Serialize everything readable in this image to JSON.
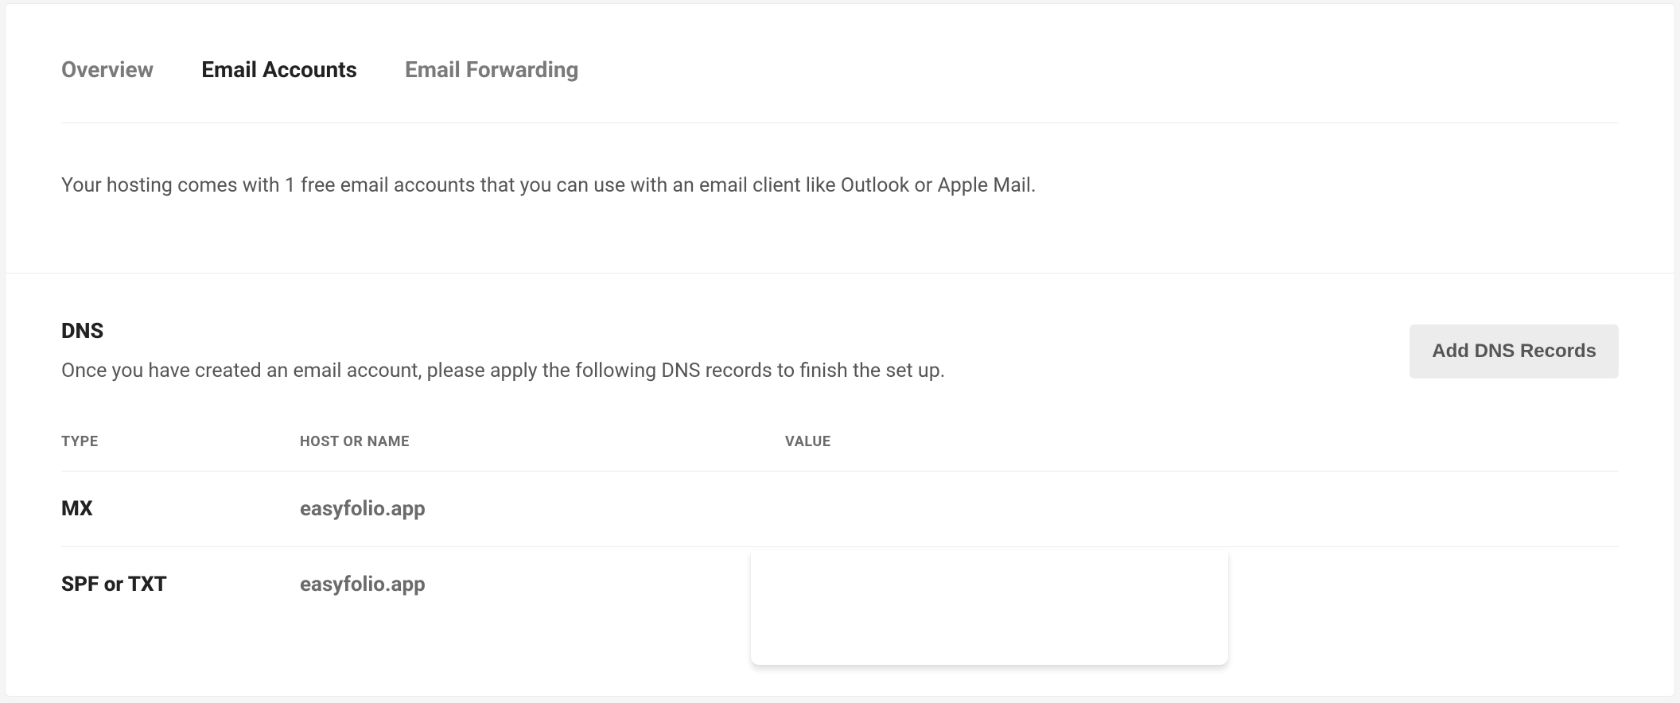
{
  "tabs": {
    "overview": "Overview",
    "email_accounts": "Email Accounts",
    "email_forwarding": "Email Forwarding"
  },
  "intro_text": "Your hosting comes with 1 free email accounts that you can use with an email client like Outlook or Apple Mail.",
  "dns": {
    "title": "DNS",
    "subtitle": "Once you have created an email account, please apply the following DNS records to finish the set up.",
    "add_button": "Add DNS Records",
    "columns": {
      "type": "TYPE",
      "host": "HOST OR NAME",
      "value": "VALUE"
    },
    "rows": [
      {
        "type": "MX",
        "host": "easyfolio.app",
        "value": ""
      },
      {
        "type": "SPF or TXT",
        "host": "easyfolio.app",
        "value": ""
      }
    ]
  }
}
